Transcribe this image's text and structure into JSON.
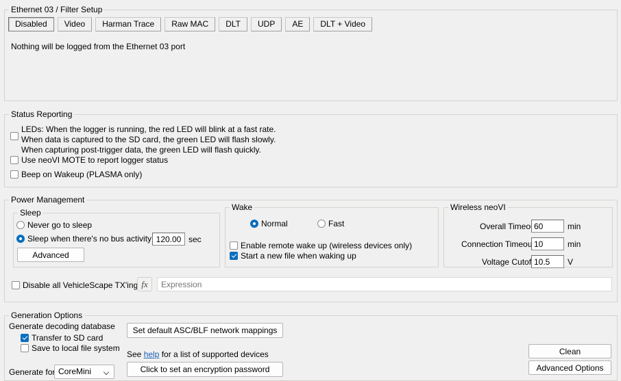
{
  "filter_setup": {
    "group_title": "Ethernet 03 / Filter Setup",
    "tabs": [
      {
        "label": "Disabled",
        "selected": true
      },
      {
        "label": "Video",
        "selected": false
      },
      {
        "label": "Harman Trace",
        "selected": false
      },
      {
        "label": "Raw MAC",
        "selected": false
      },
      {
        "label": "DLT",
        "selected": false
      },
      {
        "label": "UDP",
        "selected": false
      },
      {
        "label": "AE",
        "selected": false
      },
      {
        "label": "DLT + Video",
        "selected": false
      }
    ],
    "note": "Nothing will be logged from the Ethernet 03 port"
  },
  "status_reporting": {
    "group_title": "Status Reporting",
    "leds_checkbox": {
      "checked": false,
      "line1": "LEDs: When the logger is running, the red LED will blink at a fast rate.",
      "line2": "When data is captured to the SD card, the green LED will flash slowly.",
      "line3": "When capturing post-trigger data, the green LED will flash quickly."
    },
    "mote_checkbox": {
      "checked": false,
      "label": "Use neoVI MOTE to report logger status"
    },
    "beep_checkbox": {
      "checked": false,
      "label": "Beep on Wakeup (PLASMA only)"
    }
  },
  "power_management": {
    "group_title": "Power Management",
    "sleep": {
      "group_title": "Sleep",
      "never_radio": {
        "selected": false,
        "label": "Never go to sleep"
      },
      "inactivity_radio": {
        "selected": true,
        "label": "Sleep when there's no bus activity for"
      },
      "inactivity_value": "120.00",
      "inactivity_unit": "sec",
      "advanced_button": "Advanced"
    },
    "wake": {
      "group_title": "Wake",
      "normal_radio": {
        "selected": true,
        "label": "Normal"
      },
      "fast_radio": {
        "selected": false,
        "label": "Fast"
      },
      "remote_wake_checkbox": {
        "checked": false,
        "label": "Enable remote wake up (wireless devices only)"
      },
      "new_file_checkbox": {
        "checked": true,
        "label": "Start a new file when waking up"
      }
    },
    "wireless": {
      "group_title": "Wireless neoVI",
      "overall_timeout_label": "Overall Timeout:",
      "overall_timeout_value": "60",
      "overall_timeout_unit": "min",
      "connection_timeout_label": "Connection Timeout:",
      "connection_timeout_value": "10",
      "connection_timeout_unit": "min",
      "voltage_cutoff_label": "Voltage Cutoff:",
      "voltage_cutoff_value": "10.5",
      "voltage_cutoff_unit": "V"
    },
    "disable_tx": {
      "checkbox": {
        "checked": false,
        "label": "Disable all VehicleScape TX'ing on:"
      },
      "fx_button": "fx",
      "expression_value": "",
      "expression_placeholder": "Expression"
    }
  },
  "generation_options": {
    "group_title": "Generation Options",
    "decoding_db_label": "Generate decoding database",
    "transfer_sd_checkbox": {
      "checked": true,
      "label": "Transfer to SD card"
    },
    "save_local_checkbox": {
      "checked": false,
      "label": "Save to local file system"
    },
    "generate_for_label": "Generate for",
    "generate_for_value": "CoreMini",
    "generate_for_options": [
      "CoreMini"
    ],
    "mappings_button": "Set default ASC/BLF network mappings",
    "help_text_before": "See ",
    "help_link": "help",
    "help_text_after": " for a list of supported devices",
    "encryption_button": "Click to set an encryption password",
    "clean_button": "Clean",
    "advanced_options_button": "Advanced Options"
  },
  "colors": {
    "window_bg": "#f0f0f0",
    "accent_blue": "#0b6ebd",
    "link_blue": "#1a5fb4",
    "group_border": "#d6d3ce"
  }
}
